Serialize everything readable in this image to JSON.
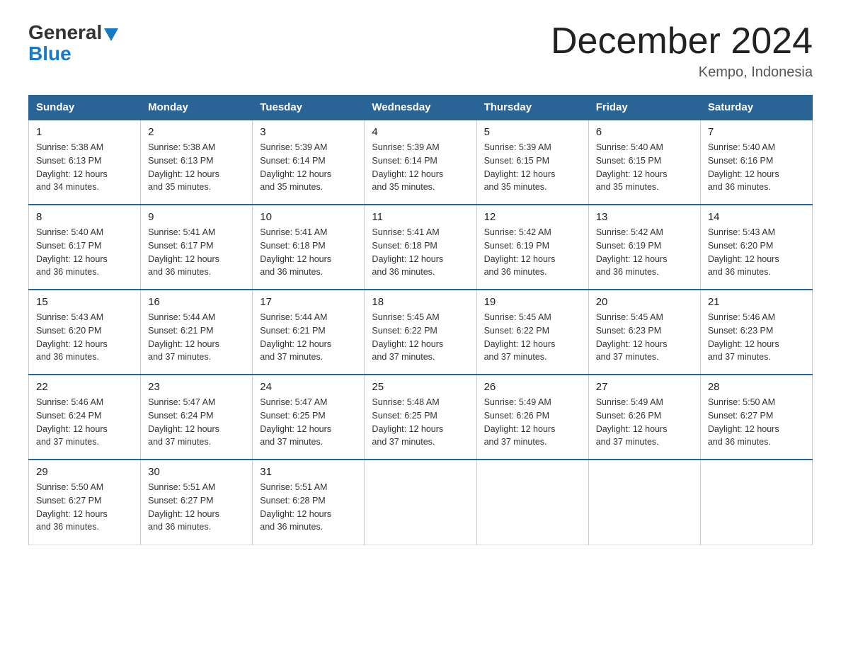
{
  "header": {
    "title": "December 2024",
    "subtitle": "Kempo, Indonesia",
    "logo_general": "General",
    "logo_blue": "Blue"
  },
  "weekdays": [
    "Sunday",
    "Monday",
    "Tuesday",
    "Wednesday",
    "Thursday",
    "Friday",
    "Saturday"
  ],
  "weeks": [
    [
      {
        "day": "1",
        "sunrise": "5:38 AM",
        "sunset": "6:13 PM",
        "daylight": "12 hours and 34 minutes."
      },
      {
        "day": "2",
        "sunrise": "5:38 AM",
        "sunset": "6:13 PM",
        "daylight": "12 hours and 35 minutes."
      },
      {
        "day": "3",
        "sunrise": "5:39 AM",
        "sunset": "6:14 PM",
        "daylight": "12 hours and 35 minutes."
      },
      {
        "day": "4",
        "sunrise": "5:39 AM",
        "sunset": "6:14 PM",
        "daylight": "12 hours and 35 minutes."
      },
      {
        "day": "5",
        "sunrise": "5:39 AM",
        "sunset": "6:15 PM",
        "daylight": "12 hours and 35 minutes."
      },
      {
        "day": "6",
        "sunrise": "5:40 AM",
        "sunset": "6:15 PM",
        "daylight": "12 hours and 35 minutes."
      },
      {
        "day": "7",
        "sunrise": "5:40 AM",
        "sunset": "6:16 PM",
        "daylight": "12 hours and 36 minutes."
      }
    ],
    [
      {
        "day": "8",
        "sunrise": "5:40 AM",
        "sunset": "6:17 PM",
        "daylight": "12 hours and 36 minutes."
      },
      {
        "day": "9",
        "sunrise": "5:41 AM",
        "sunset": "6:17 PM",
        "daylight": "12 hours and 36 minutes."
      },
      {
        "day": "10",
        "sunrise": "5:41 AM",
        "sunset": "6:18 PM",
        "daylight": "12 hours and 36 minutes."
      },
      {
        "day": "11",
        "sunrise": "5:41 AM",
        "sunset": "6:18 PM",
        "daylight": "12 hours and 36 minutes."
      },
      {
        "day": "12",
        "sunrise": "5:42 AM",
        "sunset": "6:19 PM",
        "daylight": "12 hours and 36 minutes."
      },
      {
        "day": "13",
        "sunrise": "5:42 AM",
        "sunset": "6:19 PM",
        "daylight": "12 hours and 36 minutes."
      },
      {
        "day": "14",
        "sunrise": "5:43 AM",
        "sunset": "6:20 PM",
        "daylight": "12 hours and 36 minutes."
      }
    ],
    [
      {
        "day": "15",
        "sunrise": "5:43 AM",
        "sunset": "6:20 PM",
        "daylight": "12 hours and 36 minutes."
      },
      {
        "day": "16",
        "sunrise": "5:44 AM",
        "sunset": "6:21 PM",
        "daylight": "12 hours and 37 minutes."
      },
      {
        "day": "17",
        "sunrise": "5:44 AM",
        "sunset": "6:21 PM",
        "daylight": "12 hours and 37 minutes."
      },
      {
        "day": "18",
        "sunrise": "5:45 AM",
        "sunset": "6:22 PM",
        "daylight": "12 hours and 37 minutes."
      },
      {
        "day": "19",
        "sunrise": "5:45 AM",
        "sunset": "6:22 PM",
        "daylight": "12 hours and 37 minutes."
      },
      {
        "day": "20",
        "sunrise": "5:45 AM",
        "sunset": "6:23 PM",
        "daylight": "12 hours and 37 minutes."
      },
      {
        "day": "21",
        "sunrise": "5:46 AM",
        "sunset": "6:23 PM",
        "daylight": "12 hours and 37 minutes."
      }
    ],
    [
      {
        "day": "22",
        "sunrise": "5:46 AM",
        "sunset": "6:24 PM",
        "daylight": "12 hours and 37 minutes."
      },
      {
        "day": "23",
        "sunrise": "5:47 AM",
        "sunset": "6:24 PM",
        "daylight": "12 hours and 37 minutes."
      },
      {
        "day": "24",
        "sunrise": "5:47 AM",
        "sunset": "6:25 PM",
        "daylight": "12 hours and 37 minutes."
      },
      {
        "day": "25",
        "sunrise": "5:48 AM",
        "sunset": "6:25 PM",
        "daylight": "12 hours and 37 minutes."
      },
      {
        "day": "26",
        "sunrise": "5:49 AM",
        "sunset": "6:26 PM",
        "daylight": "12 hours and 37 minutes."
      },
      {
        "day": "27",
        "sunrise": "5:49 AM",
        "sunset": "6:26 PM",
        "daylight": "12 hours and 37 minutes."
      },
      {
        "day": "28",
        "sunrise": "5:50 AM",
        "sunset": "6:27 PM",
        "daylight": "12 hours and 36 minutes."
      }
    ],
    [
      {
        "day": "29",
        "sunrise": "5:50 AM",
        "sunset": "6:27 PM",
        "daylight": "12 hours and 36 minutes."
      },
      {
        "day": "30",
        "sunrise": "5:51 AM",
        "sunset": "6:27 PM",
        "daylight": "12 hours and 36 minutes."
      },
      {
        "day": "31",
        "sunrise": "5:51 AM",
        "sunset": "6:28 PM",
        "daylight": "12 hours and 36 minutes."
      },
      null,
      null,
      null,
      null
    ]
  ],
  "labels": {
    "sunrise": "Sunrise:",
    "sunset": "Sunset:",
    "daylight": "Daylight:"
  }
}
